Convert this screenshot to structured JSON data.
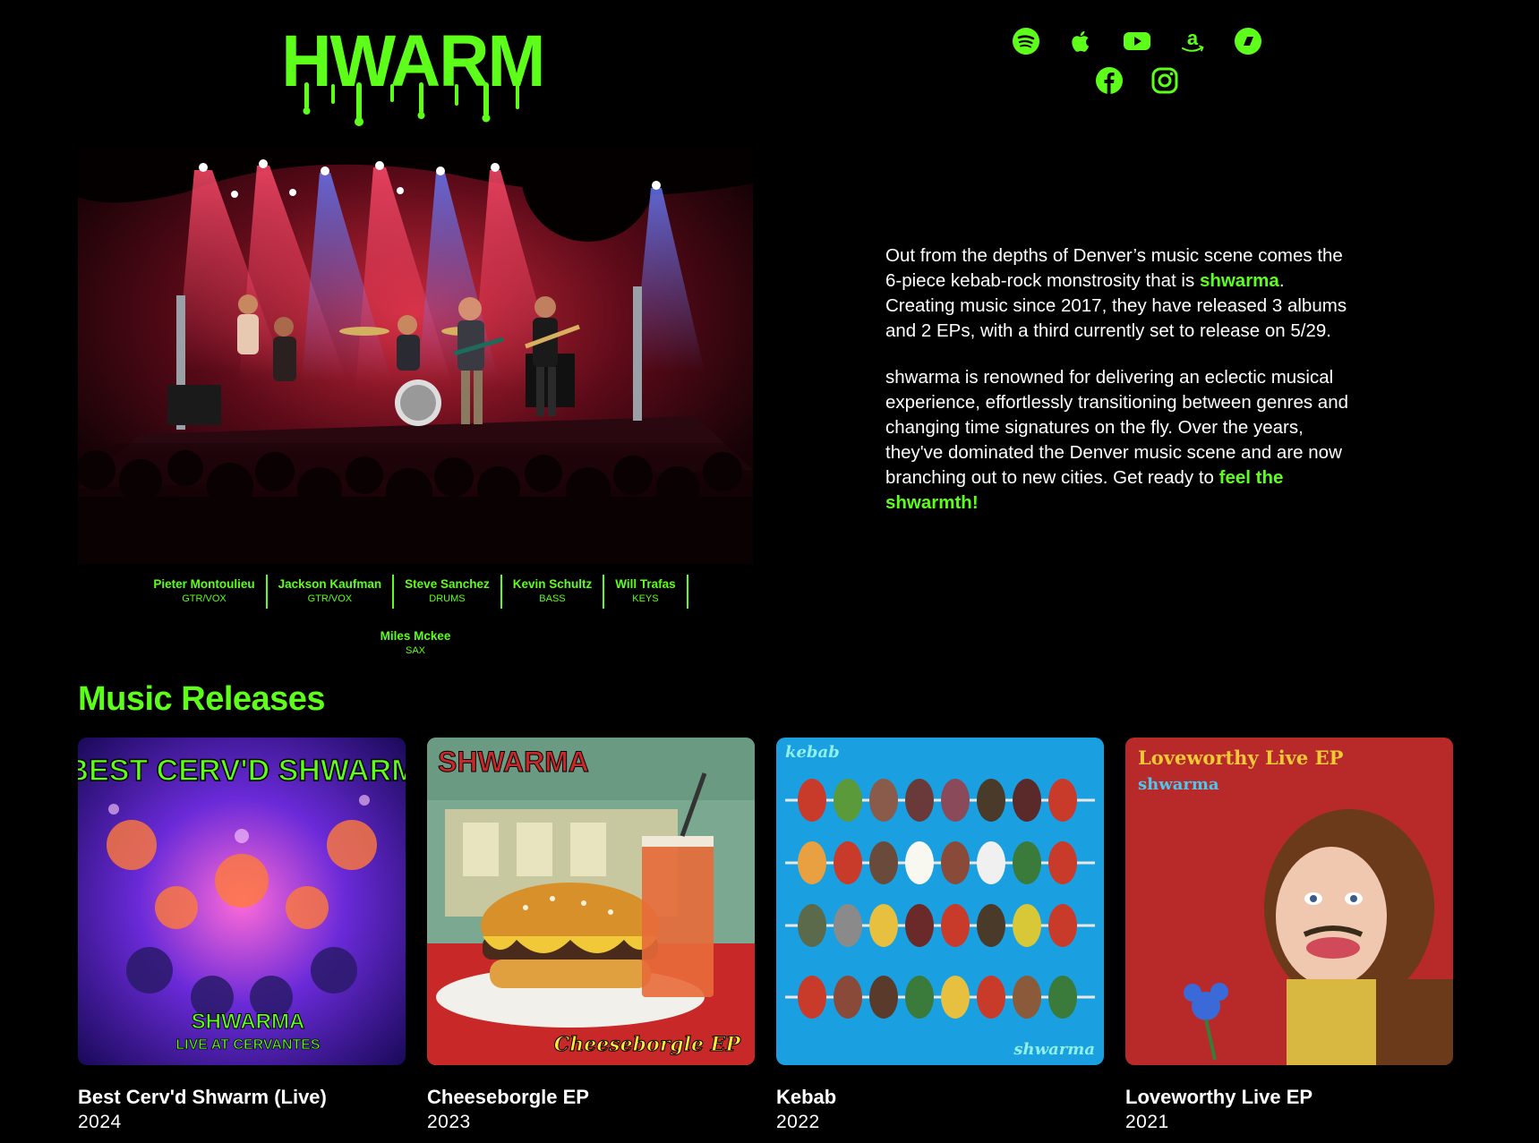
{
  "brand": {
    "logo_text": "SHWARMA",
    "accent": "#5dff1a"
  },
  "social": {
    "row1": [
      "spotify-icon",
      "apple-icon",
      "youtube-icon",
      "amazon-icon",
      "bandcamp-icon"
    ],
    "row2": [
      "facebook-icon",
      "instagram-icon"
    ]
  },
  "members": [
    {
      "name": "Pieter Montoulieu",
      "role": "GTR/VOX"
    },
    {
      "name": "Jackson Kaufman",
      "role": "GTR/VOX"
    },
    {
      "name": "Steve Sanchez",
      "role": "DRUMS"
    },
    {
      "name": "Kevin Schultz",
      "role": "BASS"
    },
    {
      "name": "Will Trafas",
      "role": "KEYS"
    },
    {
      "name": "Miles Mckee",
      "role": "SAX"
    }
  ],
  "bio": {
    "p1_a": "Out from the depths of Denver’s music scene comes the 6-piece kebab-rock monstrosity that is ",
    "p1_hl": "shwarma",
    "p1_b": ". Creating music since 2017, they have released 3 albums and 2 EPs, with a third currently set to release on 5/29.",
    "p2_a": "shwarma is renowned for delivering an eclectic musical experience, effortlessly transitioning between genres and changing time signatures on the fly. Over the years, they've dominated the Denver music scene and are now branching out to new cities. Get ready to ",
    "p2_hl": "feel the shwarmth!"
  },
  "releases_section": {
    "title": "Music Releases",
    "items": [
      {
        "title": "Best Cerv'd Shwarm (Live)",
        "year": "2024",
        "cover_text_top": "BEST CERV'D SHWARM",
        "cover_text_bottom1": "SHWARMA",
        "cover_text_bottom2": "LIVE AT CERVANTES"
      },
      {
        "title": "Cheeseborgle EP",
        "year": "2023",
        "cover_text_top": "SHWARMA",
        "cover_text_bottom1": "Cheeseborgle EP",
        "cover_text_bottom2": ""
      },
      {
        "title": "Kebab",
        "year": "2022",
        "cover_text_top": "kebab",
        "cover_text_bottom1": "shwarma",
        "cover_text_bottom2": ""
      },
      {
        "title": "Loveworthy Live EP",
        "year": "2021",
        "cover_text_top": "Loveworthy Live EP",
        "cover_text_bottom1": "shwarma",
        "cover_text_bottom2": ""
      }
    ]
  }
}
